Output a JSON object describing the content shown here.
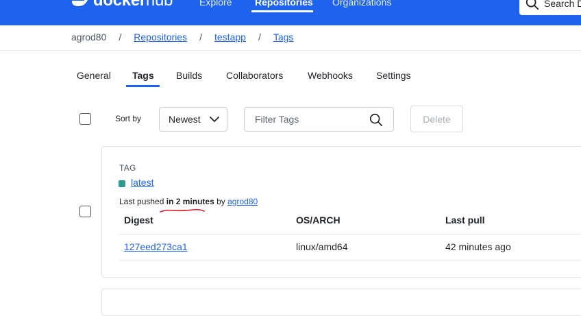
{
  "nav": {
    "logo_docker": "docker",
    "logo_hub": "hub",
    "links": [
      "Explore",
      "Repositories",
      "Organizations"
    ],
    "search_placeholder": "Search D",
    "color": "#1d63ed"
  },
  "breadcrumb": {
    "user": "agrod80",
    "sep": "/",
    "items": [
      "Repositories",
      "testapp",
      "Tags"
    ]
  },
  "tabs": [
    "General",
    "Tags",
    "Builds",
    "Collaborators",
    "Webhooks",
    "Settings"
  ],
  "active_tab": "Tags",
  "toolbar": {
    "sort_label": "Sort by",
    "sort_value": "Newest",
    "filter_placeholder": "Filter Tags",
    "delete_label": "Delete"
  },
  "tag": {
    "section_label": "TAG",
    "name": "latest",
    "pushed_prefix": "Last pushed",
    "pushed_time": "in 2 minutes",
    "pushed_by": "by",
    "pusher": "agrod80",
    "status_color": "#2a9d8f"
  },
  "table": {
    "headers": [
      "Digest",
      "OS/ARCH",
      "Last pull"
    ],
    "rows": [
      {
        "digest": "127eed273ca1",
        "os_arch": "linux/amd64",
        "last_pull": "42 minutes ago"
      }
    ]
  },
  "icons": {
    "logo": "docker-whale-icon",
    "search": "search-icon",
    "dropdown": "chevron-down-icon",
    "checkbox": "checkbox-icon"
  }
}
